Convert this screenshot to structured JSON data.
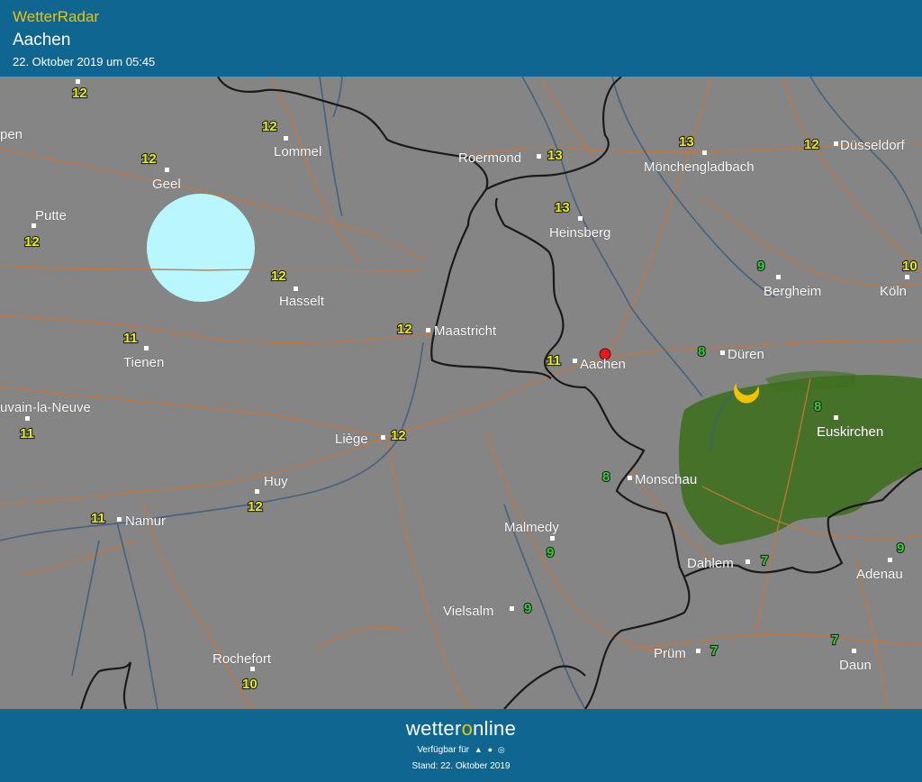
{
  "header": {
    "brand": "WetterRadar",
    "city": "Aachen",
    "date": "22. Oktober 2019 um 05:45"
  },
  "colors": {
    "header_bg": "#0f6690",
    "brand_yellow": "#f2c200",
    "land": "#858585",
    "rain_green": "#3f6f1e",
    "temp_yellow": "#e6ec19",
    "temp_green": "#2fd02f",
    "roads": "#c8763a",
    "rivers": "#3f5f80",
    "borders": "#1a1a1a"
  },
  "map": {
    "marker": "location-pin-icon",
    "places": [
      {
        "name": "",
        "temp": "12",
        "color": "yellow"
      },
      {
        "name": "Lommel",
        "temp": "12",
        "color": "yellow"
      },
      {
        "name": "pen",
        "temp": "",
        "color": "yellow"
      },
      {
        "name": "Geel",
        "temp": "12",
        "color": "yellow"
      },
      {
        "name": "Putte",
        "temp": "12",
        "color": "yellow"
      },
      {
        "name": "Hasselt",
        "temp": "12",
        "color": "yellow"
      },
      {
        "name": "Tienen",
        "temp": "11",
        "color": "yellow"
      },
      {
        "name": "uvain-la-Neuve",
        "temp": "11",
        "color": "yellow"
      },
      {
        "name": "Maastricht",
        "temp": "12",
        "color": "yellow"
      },
      {
        "name": "Roermond",
        "temp": "13",
        "color": "yellow"
      },
      {
        "name": "Mönchengladbach",
        "temp": "13",
        "color": "yellow"
      },
      {
        "name": "Düsseldorf",
        "temp": "12",
        "color": "yellow"
      },
      {
        "name": "Heinsberg",
        "temp": "13",
        "color": "yellow"
      },
      {
        "name": "Bergheim",
        "temp": "9",
        "color": "green"
      },
      {
        "name": "Köln",
        "temp": "10",
        "color": "yellow"
      },
      {
        "name": "Aachen",
        "temp": "11",
        "color": "yellow"
      },
      {
        "name": "Düren",
        "temp": "8",
        "color": "green"
      },
      {
        "name": "Euskirchen",
        "temp": "8",
        "color": "green"
      },
      {
        "name": "Liège",
        "temp": "12",
        "color": "yellow"
      },
      {
        "name": "Huy",
        "temp": "12",
        "color": "yellow"
      },
      {
        "name": "Namur",
        "temp": "11",
        "color": "yellow"
      },
      {
        "name": "Monschau",
        "temp": "8",
        "color": "green"
      },
      {
        "name": "Malmedy",
        "temp": "9",
        "color": "green"
      },
      {
        "name": "Dahlem",
        "temp": "7",
        "color": "green"
      },
      {
        "name": "Adenau",
        "temp": "9",
        "color": "green"
      },
      {
        "name": "Vielsalm",
        "temp": "9",
        "color": "green"
      },
      {
        "name": "Prüm",
        "temp": "7",
        "color": "green"
      },
      {
        "name": "Daun",
        "temp": "7",
        "color": "green"
      },
      {
        "name": "Rochefort",
        "temp": "10",
        "color": "yellow"
      }
    ],
    "weather_icons": [
      "moon-icon",
      "moon-icon",
      "moon-icon",
      "sun-icon"
    ]
  },
  "footer": {
    "logo_pre": "wetter",
    "logo_o": "o",
    "logo_post": "nline",
    "available": "Verfügbar für",
    "platforms": [
      "android-icon",
      "apple-icon",
      "web-icon"
    ],
    "stand": "Stand: 22. Oktober 2019"
  }
}
